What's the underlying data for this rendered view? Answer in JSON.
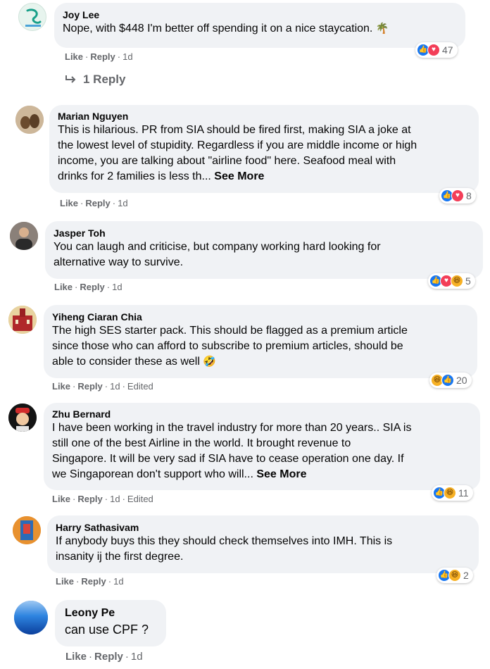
{
  "comments": [
    {
      "author": "Joy Lee",
      "lines": [
        "Nope, with $448 I'm better off spending it on a nice staycation."
      ],
      "emoji": "🌴",
      "see_more": "",
      "actions": {
        "like": "Like",
        "reply": "Reply",
        "time": "1d",
        "edited": ""
      },
      "reactions": [
        "like",
        "love"
      ],
      "count": "47",
      "replies_label": "1 Reply"
    },
    {
      "author": "Marian Nguyen",
      "lines": [
        "This is hilarious. PR from SIA should be fired first, making SIA a joke at",
        "the lowest level of stupidity. Regardless if you are middle income or high",
        "income, you are talking about \"airline food\" here. Seafood meal with",
        "drinks for 2 families is less th..."
      ],
      "see_more": "See More",
      "actions": {
        "like": "Like",
        "reply": "Reply",
        "time": "1d",
        "edited": ""
      },
      "reactions": [
        "like",
        "love"
      ],
      "count": "8"
    },
    {
      "author": "Jasper Toh",
      "lines": [
        "You can laugh and criticise, but company working hard looking for",
        "alternative way to survive."
      ],
      "see_more": "",
      "actions": {
        "like": "Like",
        "reply": "Reply",
        "time": "1d",
        "edited": ""
      },
      "reactions": [
        "like",
        "love",
        "haha"
      ],
      "count": "5"
    },
    {
      "author": "Yiheng Ciaran Chia",
      "lines": [
        "The high SES starter pack. This should be flagged as a premium article",
        "since those who can afford to subscribe to premium articles, should be",
        "able to consider these as well"
      ],
      "emoji": "🤣",
      "see_more": "",
      "actions": {
        "like": "Like",
        "reply": "Reply",
        "time": "1d",
        "edited": "Edited"
      },
      "reactions": [
        "haha",
        "like"
      ],
      "count": "20"
    },
    {
      "author": "Zhu Bernard",
      "lines": [
        "I have been working in the travel industry for more than 20 years.. SIA is",
        "still one of the best Airline in the world. It brought revenue to",
        "Singapore. It will be very sad if SIA have to cease operation one day. If",
        "we Singaporean don't support who will..."
      ],
      "see_more": "See More",
      "actions": {
        "like": "Like",
        "reply": "Reply",
        "time": "1d",
        "edited": "Edited"
      },
      "reactions": [
        "like",
        "haha"
      ],
      "count": "11"
    },
    {
      "author": "Harry Sathasivam",
      "lines": [
        "If anybody buys this they should check themselves into IMH. This is",
        "insanity ij the first degree."
      ],
      "see_more": "",
      "actions": {
        "like": "Like",
        "reply": "Reply",
        "time": "1d",
        "edited": ""
      },
      "reactions": [
        "like",
        "haha"
      ],
      "count": "2"
    },
    {
      "author": "Leony Pe",
      "lines": [
        "can use CPF ?"
      ],
      "see_more": "",
      "actions": {
        "like": "Like",
        "reply": "Reply",
        "time": "1d",
        "edited": ""
      },
      "reactions": [],
      "count": ""
    }
  ],
  "colors": {
    "bubble": "#f0f2f5",
    "secondary_text": "#65676b",
    "like": "#1877f2",
    "love": "#f33e58",
    "haha": "#f7b125"
  }
}
